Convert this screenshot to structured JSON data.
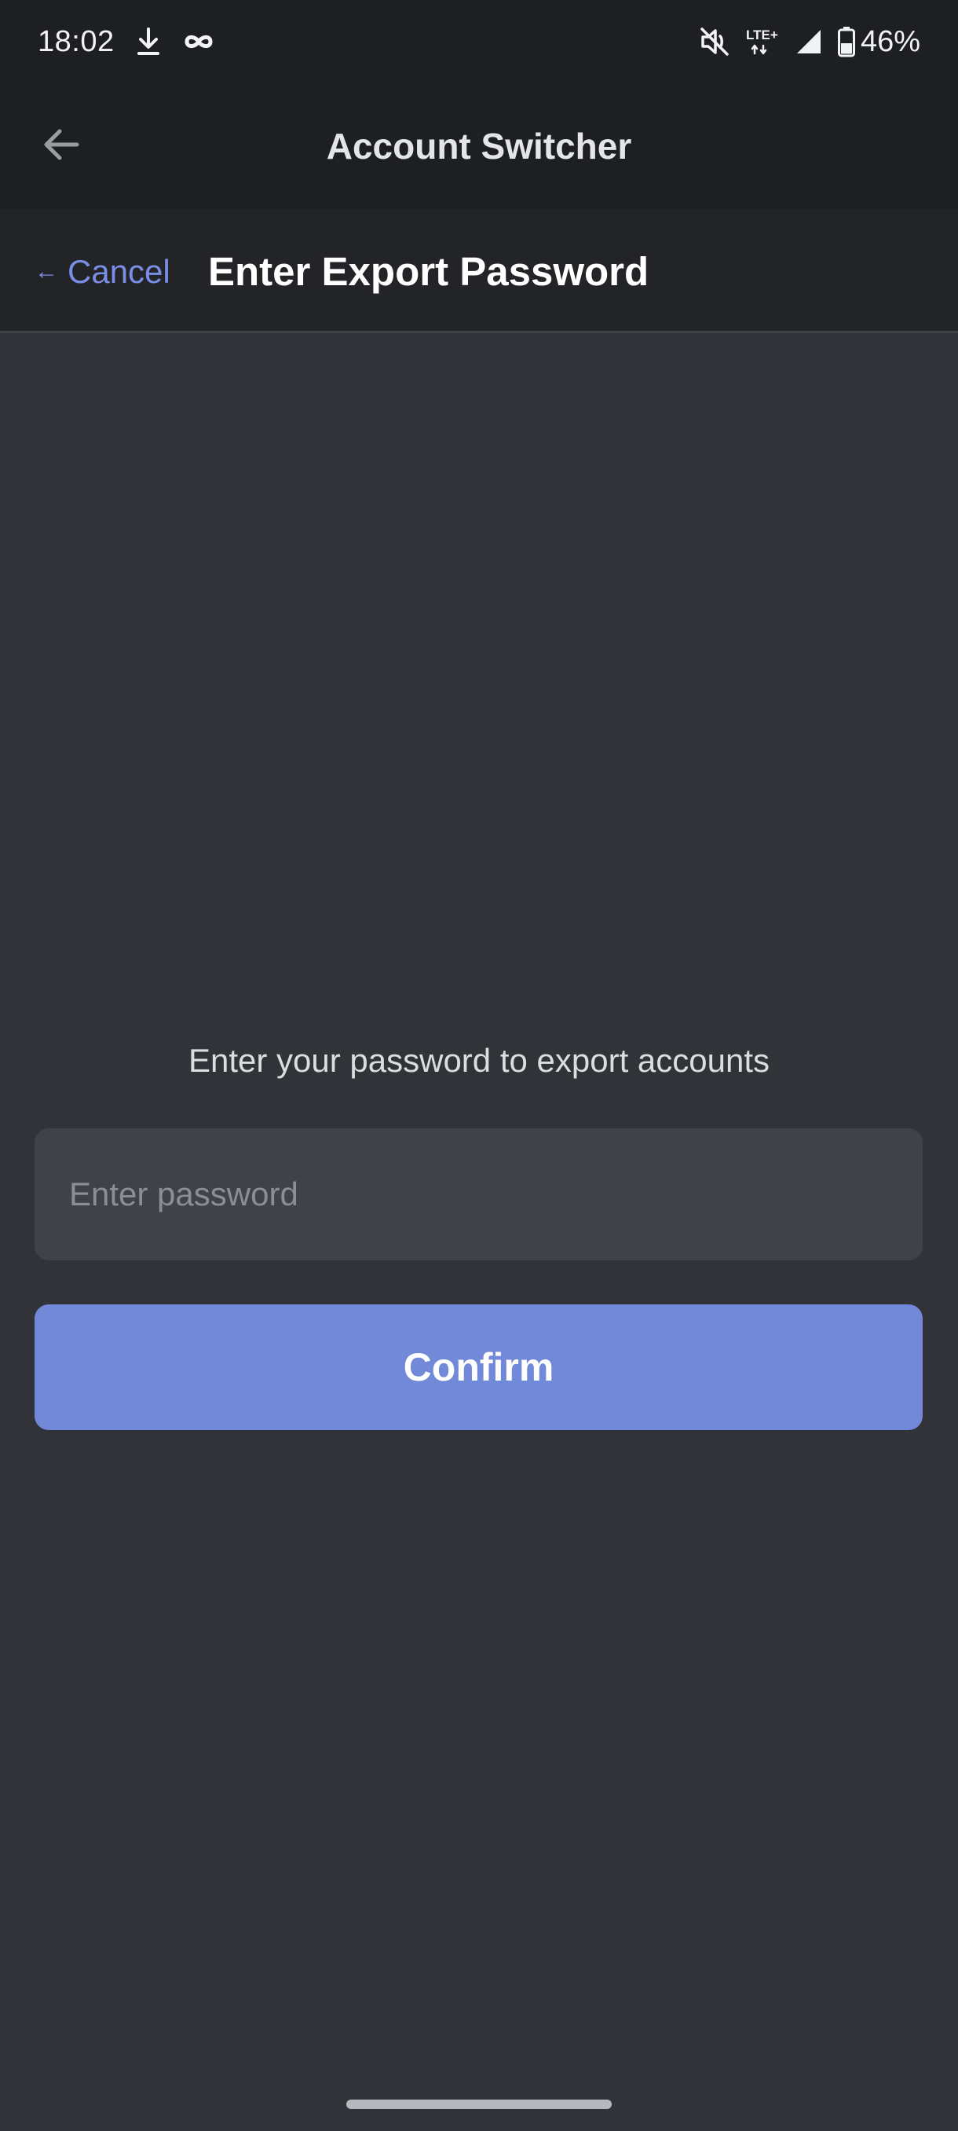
{
  "status_bar": {
    "time": "18:02",
    "battery_percent": "46%",
    "network_label": "LTE+",
    "left_icons": [
      "download-icon",
      "infinity-icon"
    ],
    "right_icons": [
      "mute-icon",
      "lte-icon",
      "signal-icon",
      "battery-icon"
    ]
  },
  "app_bar": {
    "title": "Account Switcher",
    "back_icon": "arrow-left-icon"
  },
  "header": {
    "cancel_label": "Cancel",
    "cancel_arrow": "←",
    "title": "Enter Export Password"
  },
  "main": {
    "prompt": "Enter your password to export accounts",
    "password_value": "",
    "password_placeholder": "Enter password",
    "confirm_label": "Confirm"
  },
  "colors": {
    "background": "#313338",
    "bar_background": "#1e1f22",
    "header_background": "#232428",
    "input_background": "#404249",
    "accent": "#7289da",
    "link": "#7a8ee6"
  }
}
